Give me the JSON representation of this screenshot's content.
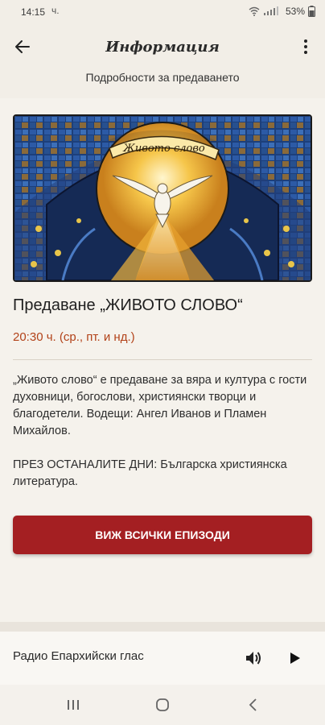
{
  "status_bar": {
    "time": "14:15",
    "notification": "ч.",
    "battery": "53%"
  },
  "app_bar": {
    "title": "Информация",
    "subtitle": "Подробности за предаването"
  },
  "show": {
    "hero_text": "Живото слово",
    "title": "Предаване „ЖИВОТО СЛОВО“",
    "schedule": "20:30 ч. (ср., пт. и нд.)",
    "description": [
      "„Живото слово“ е предаване за вяра и култура с гости духовници, богослови, християнски творци и благодетели. Водещи: Ангел Иванов и Пламен Михайлов.",
      "ПРЕЗ ОСТАНАЛИТЕ ДНИ: Българска християнска литература."
    ],
    "cta_label": "ВИЖ ВСИЧКИ ЕПИЗОДИ"
  },
  "player": {
    "station": "Радио Епархийски глас"
  },
  "colors": {
    "accent": "#a41f22",
    "schedule": "#b24219",
    "background": "#f5f2ec"
  },
  "icons": [
    "back-arrow-icon",
    "more-vert-icon",
    "volume-icon",
    "play-icon",
    "recents-icon",
    "home-icon",
    "back-nav-icon",
    "wifi-icon",
    "signal-icon",
    "battery-icon"
  ]
}
